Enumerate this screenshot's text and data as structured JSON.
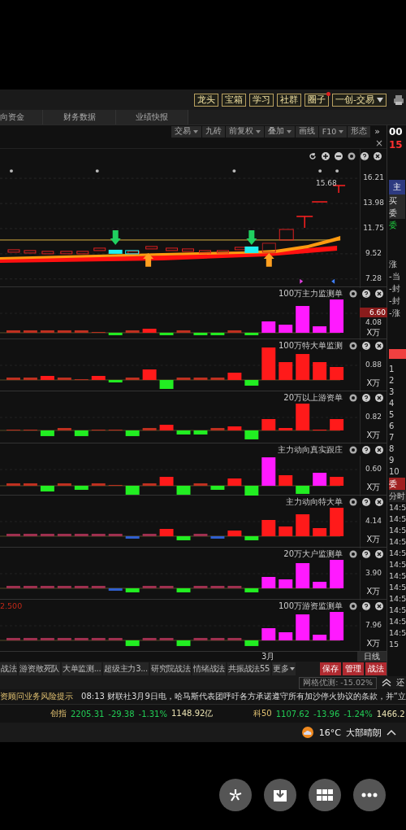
{
  "top_buttons": [
    {
      "label": "龙头",
      "badge": false
    },
    {
      "label": "宝箱",
      "badge": false
    },
    {
      "label": "学习",
      "badge": false
    },
    {
      "label": "社群",
      "badge": false
    },
    {
      "label": "圈子",
      "badge": true
    }
  ],
  "account_menu": {
    "label": "一创-交易"
  },
  "tabs": [
    "向资金",
    "财务数据",
    "业绩快报"
  ],
  "toolbar": [
    {
      "label": "交易",
      "dropdown": true
    },
    {
      "label": "九砖",
      "dropdown": false
    },
    {
      "label": "前复权",
      "dropdown": true
    },
    {
      "label": "叠加",
      "dropdown": true
    },
    {
      "label": "画线",
      "dropdown": false
    },
    {
      "label": "F10",
      "dropdown": true
    },
    {
      "label": "形态",
      "dropdown": false
    }
  ],
  "toolbar_more": "»",
  "close_mark": "×",
  "main_chart": {
    "price_label": "15.68",
    "axis": [
      "16.21",
      "13.98",
      "11.75",
      "9.52",
      "7.28"
    ]
  },
  "panels": [
    {
      "title": "100万主力监测单",
      "values": [
        {
          "text": "6.60",
          "highlight": true
        },
        {
          "text": "4.08",
          "highlight": false
        }
      ],
      "unit": "X万"
    },
    {
      "title": "100万特大单监测",
      "values": [
        {
          "text": "0.88",
          "highlight": false
        }
      ],
      "unit": "X万"
    },
    {
      "title": "20万以上游资单",
      "values": [
        {
          "text": "0.82",
          "highlight": false
        }
      ],
      "unit": "X万"
    },
    {
      "title": "主力动向真实跟庄",
      "values": [
        {
          "text": "0.60",
          "highlight": false
        }
      ],
      "unit": "X万"
    },
    {
      "title": "主力动向特大单",
      "values": [
        {
          "text": "4.14",
          "highlight": false
        }
      ],
      "unit": "X万"
    },
    {
      "title": "20万大户监测单",
      "values": [
        {
          "text": "3.90",
          "highlight": false
        }
      ],
      "unit": "X万"
    },
    {
      "title": "100万游资监测单",
      "values": [
        {
          "text": "7.96",
          "highlight": false
        }
      ],
      "unit": "X万",
      "left_label": "2.500"
    }
  ],
  "x_axis": {
    "label": "3月",
    "period": "日线"
  },
  "strategies": [
    "战法",
    "游资敢死队",
    "大单监测...",
    "超级主力3...",
    "研究院战法",
    "情绪战法",
    "共振战法55"
  ],
  "strategies_more": "更多",
  "actions": [
    "保存",
    "管理",
    "战法"
  ],
  "grid_test": "网格优测: -15.02%",
  "side_label": "还",
  "quote_panel": {
    "code": "00",
    "price": "15",
    "tab": "主",
    "rows": [
      "买",
      "委"
    ],
    "ratio": "委",
    "notes": [
      "涨",
      "-当",
      "-封",
      "-封",
      "-涨"
    ],
    "levels": [
      "1",
      "2",
      "3",
      "4",
      "5",
      "6",
      "7",
      "8",
      "9",
      "10"
    ],
    "sell_tab": "委",
    "time_tab": "分时",
    "times": [
      "14:5",
      "14:5",
      "14:5",
      "14:5",
      "14:5",
      "14:5",
      "14:5",
      "14:5",
      "14:5",
      "14:5",
      "14:5",
      "14:5"
    ],
    "last_time": "15"
  },
  "news": {
    "notice": "资顾问业务风险提示",
    "headline": "08:13 财联社3月9日电，哈马斯代表团呼吁各方承诺遵守所有加沙停火协议的条款，并“立"
  },
  "indices": [
    {
      "name": "创指",
      "value": "2205.31",
      "change": "-29.38",
      "pct": "-1.31%",
      "amount": "1148.92亿"
    },
    {
      "name": "科50",
      "value": "1107.62",
      "change": "-13.96",
      "pct": "-1.24%",
      "amount": "1466.2"
    }
  ],
  "taskbar": {
    "temperature": "16°C",
    "condition": "大部晴朗"
  }
}
